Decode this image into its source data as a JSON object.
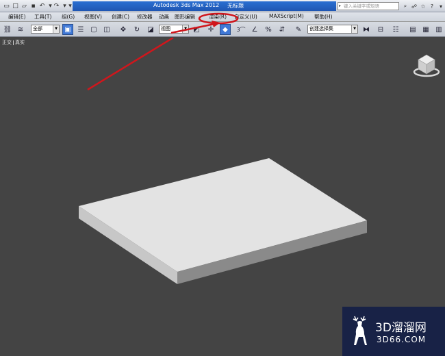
{
  "titlebar": {
    "title_app": "Autodesk 3ds Max  2012",
    "title_file": "无标题",
    "search_placeholder": "键入关键字或短语"
  },
  "menubar": {
    "items": [
      {
        "label": "编辑(E)"
      },
      {
        "label": "工具(T)"
      },
      {
        "label": "组(G)"
      },
      {
        "label": "视图(V)"
      },
      {
        "label": "创建(C)"
      },
      {
        "label": "修改器"
      },
      {
        "label": "动画"
      },
      {
        "label": "图形编辑"
      },
      {
        "label": "渲染(R)"
      },
      {
        "label": "自定义(U)"
      },
      {
        "label": "MAXScript(M)"
      },
      {
        "label": "帮助(H)"
      }
    ]
  },
  "toolbar": {
    "selection_filter": "全部",
    "reference_coord": "视图",
    "named_selection": "创建选择集",
    "snap_value": "3"
  },
  "viewport": {
    "label_view": "正交",
    "label_shading": "真实",
    "box_top_color": "#e3e3e3",
    "box_front_color": "#c7c7c7",
    "box_side_color": "#8a8a8a"
  },
  "annotation": {
    "arrow_color": "#d0161c"
  },
  "watermark": {
    "line1": "3D溜溜网",
    "line2": "3D66.COM"
  }
}
